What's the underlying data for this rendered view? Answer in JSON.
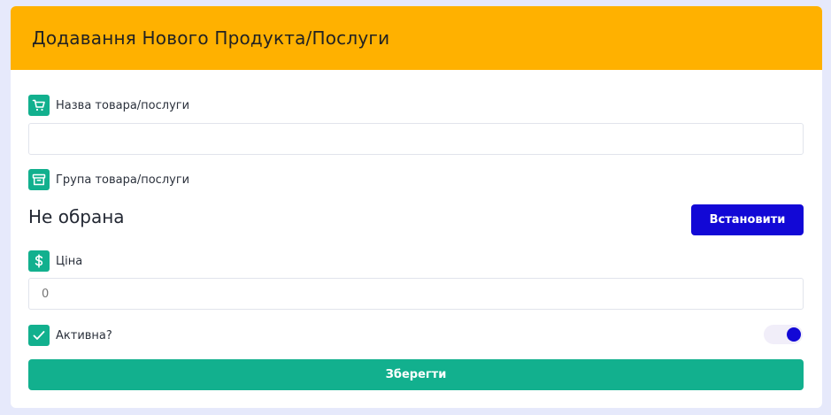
{
  "header": {
    "title": "Додавання Нового Продукта/Послуги"
  },
  "form": {
    "name": {
      "icon": "shopping-cart-icon",
      "label": "Назва товара/послуги",
      "value": "",
      "placeholder": ""
    },
    "group": {
      "icon": "archive-box-icon",
      "label": "Група товара/послуги",
      "value": "Не обрана",
      "set_button_label": "Встановити"
    },
    "price": {
      "icon": "dollar-sign-icon",
      "label": "Ціна",
      "placeholder": "0"
    },
    "active": {
      "icon": "checkmark-icon",
      "label": "Активна?",
      "toggle_on": true
    },
    "save_button_label": "Зберегти"
  },
  "colors": {
    "header_bg": "#ffb100",
    "accent_green": "#12b08e",
    "accent_blue": "#1208d6",
    "page_bg": "#e6e9fb"
  }
}
